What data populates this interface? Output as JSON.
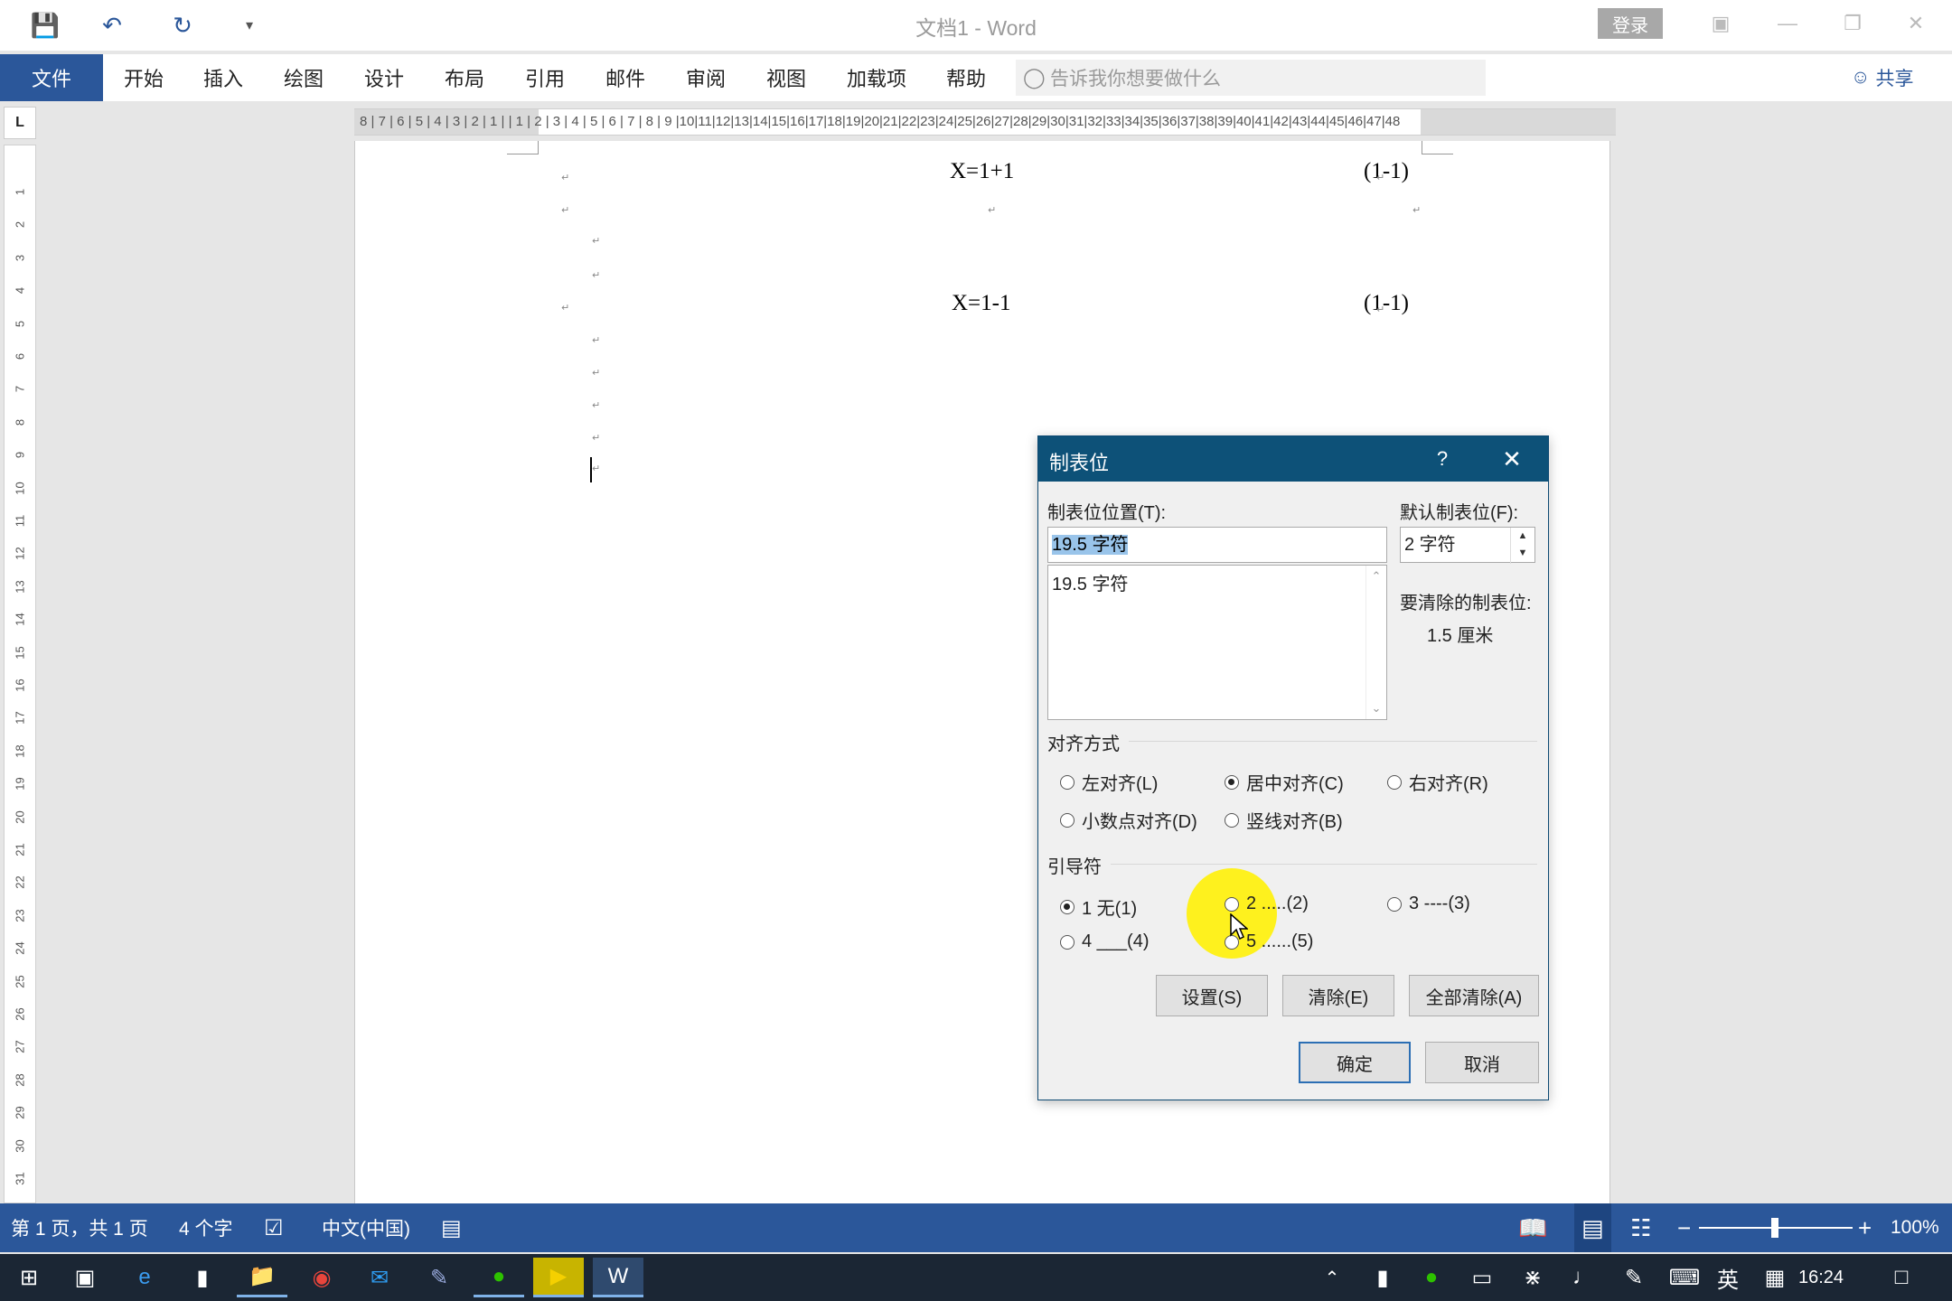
{
  "window": {
    "title": "文档1  -  Word",
    "login_label": "登录",
    "share_label": "共享"
  },
  "ribbon": {
    "tabs": [
      "文件",
      "开始",
      "插入",
      "绘图",
      "设计",
      "布局",
      "引用",
      "邮件",
      "审阅",
      "视图",
      "加载项",
      "帮助"
    ],
    "tell_me_placeholder": "告诉我你想要做什么"
  },
  "ruler": {
    "corner_label": "L",
    "h_numbers": "8 | 7 | 6 | 5 | 4 | 3 | 2 | 1 |     | 1 | 2 | 3 | 4 | 5 | 6 | 7 | 8 | 9 |10|11|12|13|14|15|16|17|18|19|20|21|22|23|24|25|26|27|28|29|30|31|32|33|34|35|36|37|38|39|40|41|42|43|44|45|46|47|48",
    "v_numbers": [
      "1",
      "2",
      "3",
      "4",
      "5",
      "6",
      "7",
      "8",
      "9",
      "10",
      "11",
      "12",
      "13",
      "14",
      "15",
      "16",
      "17",
      "18",
      "19",
      "20",
      "21",
      "22",
      "23",
      "24",
      "25",
      "26",
      "27",
      "28",
      "29",
      "30",
      "31"
    ]
  },
  "document": {
    "equations": [
      {
        "formula": "X=1+1",
        "number": "(1-1)"
      },
      {
        "formula": "X=1-1",
        "number": "(1-1)"
      }
    ],
    "para_mark": "↵"
  },
  "dialog": {
    "title": "制表位",
    "help": "?",
    "tab_position_label": "制表位位置(T):",
    "tab_position_value": "19.5 字符",
    "tab_list": [
      "19.5 字符"
    ],
    "default_tab_label": "默认制表位(F):",
    "default_tab_value": "2 字符",
    "clear_label": "要清除的制表位:",
    "clear_value": "1.5 厘米",
    "alignment_label": "对齐方式",
    "alignment_options": [
      {
        "label": "左对齐(L)",
        "checked": false
      },
      {
        "label": "居中对齐(C)",
        "checked": true
      },
      {
        "label": "右对齐(R)",
        "checked": false
      },
      {
        "label": "小数点对齐(D)",
        "checked": false
      },
      {
        "label": "竖线对齐(B)",
        "checked": false
      }
    ],
    "leader_label": "引导符",
    "leader_options": [
      {
        "label": "1 无(1)",
        "checked": true
      },
      {
        "label": "2 .....(2)",
        "checked": false
      },
      {
        "label": "3 ----(3)",
        "checked": false
      },
      {
        "label": "4 ___(4)",
        "checked": false
      },
      {
        "label": "5 ......(5)",
        "checked": false
      }
    ],
    "buttons": {
      "set": "设置(S)",
      "clear": "清除(E)",
      "clear_all": "全部清除(A)",
      "ok": "确定",
      "cancel": "取消"
    }
  },
  "status_bar": {
    "page": "第 1 页，共 1 页",
    "words": "4 个字",
    "language": "中文(中国)",
    "zoom": "100%"
  },
  "taskbar": {
    "time": "16:24",
    "ime": "英"
  },
  "colors": {
    "accent": "#2b579a",
    "dialog_title": "#0d5178",
    "highlight": "#fff000"
  }
}
